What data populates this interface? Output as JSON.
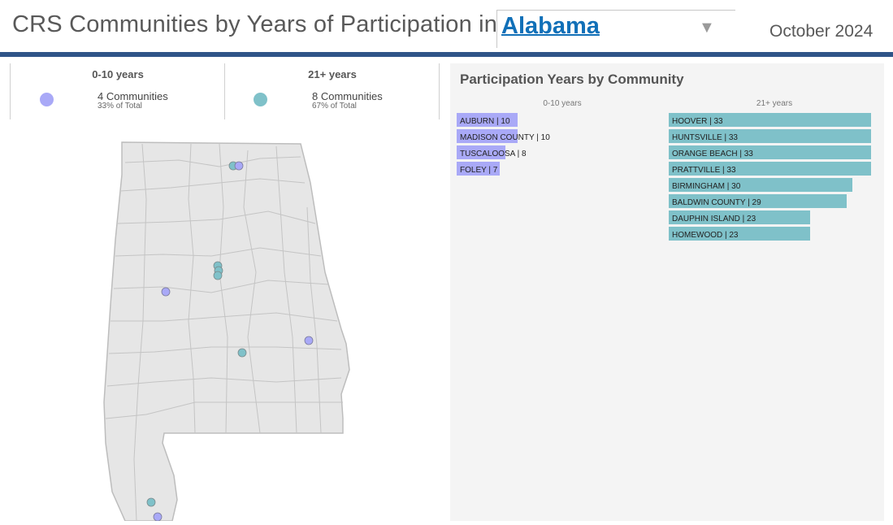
{
  "header": {
    "title": "CRS Communities by Years of Participation in",
    "state_select": {
      "selected": "Alabama"
    },
    "date": "October 2024"
  },
  "colors": {
    "group_0_10": "#a9a9f7",
    "group_21_plus": "#7fc1c9",
    "rule": "#2f5488",
    "link": "#1170b8",
    "map_fill": "#e6e6e6",
    "map_stroke": "#bdbdbd"
  },
  "kpis": [
    {
      "heading": "0-10 years",
      "count_text": "4 Communities",
      "pct_text": "33% of Total",
      "count": 4,
      "pct": 33
    },
    {
      "heading": "21+ years",
      "count_text": "8 Communities",
      "pct_text": "67% of Total",
      "count": 8,
      "pct": 67
    }
  ],
  "chart_data": {
    "type": "bar",
    "title": "Participation Years by Community",
    "orientation": "horizontal",
    "xlim": [
      0,
      33
    ],
    "series": [
      {
        "name": "0-10 years",
        "categories": [
          "AUBURN",
          "MADISON COUNTY",
          "TUSCALOOSA",
          "FOLEY"
        ],
        "values": [
          10,
          10,
          8,
          7
        ],
        "labels": [
          "AUBURN | 10",
          "MADISON COUNTY | 10",
          "TUSCALOOSA | 8",
          "FOLEY | 7"
        ]
      },
      {
        "name": "21+ years",
        "categories": [
          "HOOVER",
          "HUNTSVILLE",
          "ORANGE BEACH",
          "PRATTVILLE",
          "BIRMINGHAM",
          "BALDWIN COUNTY",
          "DAUPHIN ISLAND",
          "HOMEWOOD"
        ],
        "values": [
          33,
          33,
          33,
          33,
          30,
          29,
          23,
          23
        ],
        "labels": [
          "HOOVER | 33",
          "HUNTSVILLE | 33",
          "ORANGE BEACH | 33",
          "PRATTVILLE | 33",
          "BIRMINGHAM | 30",
          "BALDWIN COUNTY | 29",
          "DAUPHIN ISLAND | 23",
          "HOMEWOOD | 23"
        ]
      }
    ]
  },
  "map": {
    "state": "Alabama",
    "points": [
      {
        "community": "HUNTSVILLE",
        "group": "21+ years"
      },
      {
        "community": "MADISON COUNTY",
        "group": "0-10 years"
      },
      {
        "community": "HOOVER",
        "group": "21+ years"
      },
      {
        "community": "BIRMINGHAM",
        "group": "21+ years"
      },
      {
        "community": "HOMEWOOD",
        "group": "21+ years"
      },
      {
        "community": "TUSCALOOSA",
        "group": "0-10 years"
      },
      {
        "community": "AUBURN",
        "group": "0-10 years"
      },
      {
        "community": "PRATTVILLE",
        "group": "21+ years"
      },
      {
        "community": "BALDWIN COUNTY",
        "group": "21+ years"
      },
      {
        "community": "FOLEY",
        "group": "0-10 years"
      }
    ]
  }
}
